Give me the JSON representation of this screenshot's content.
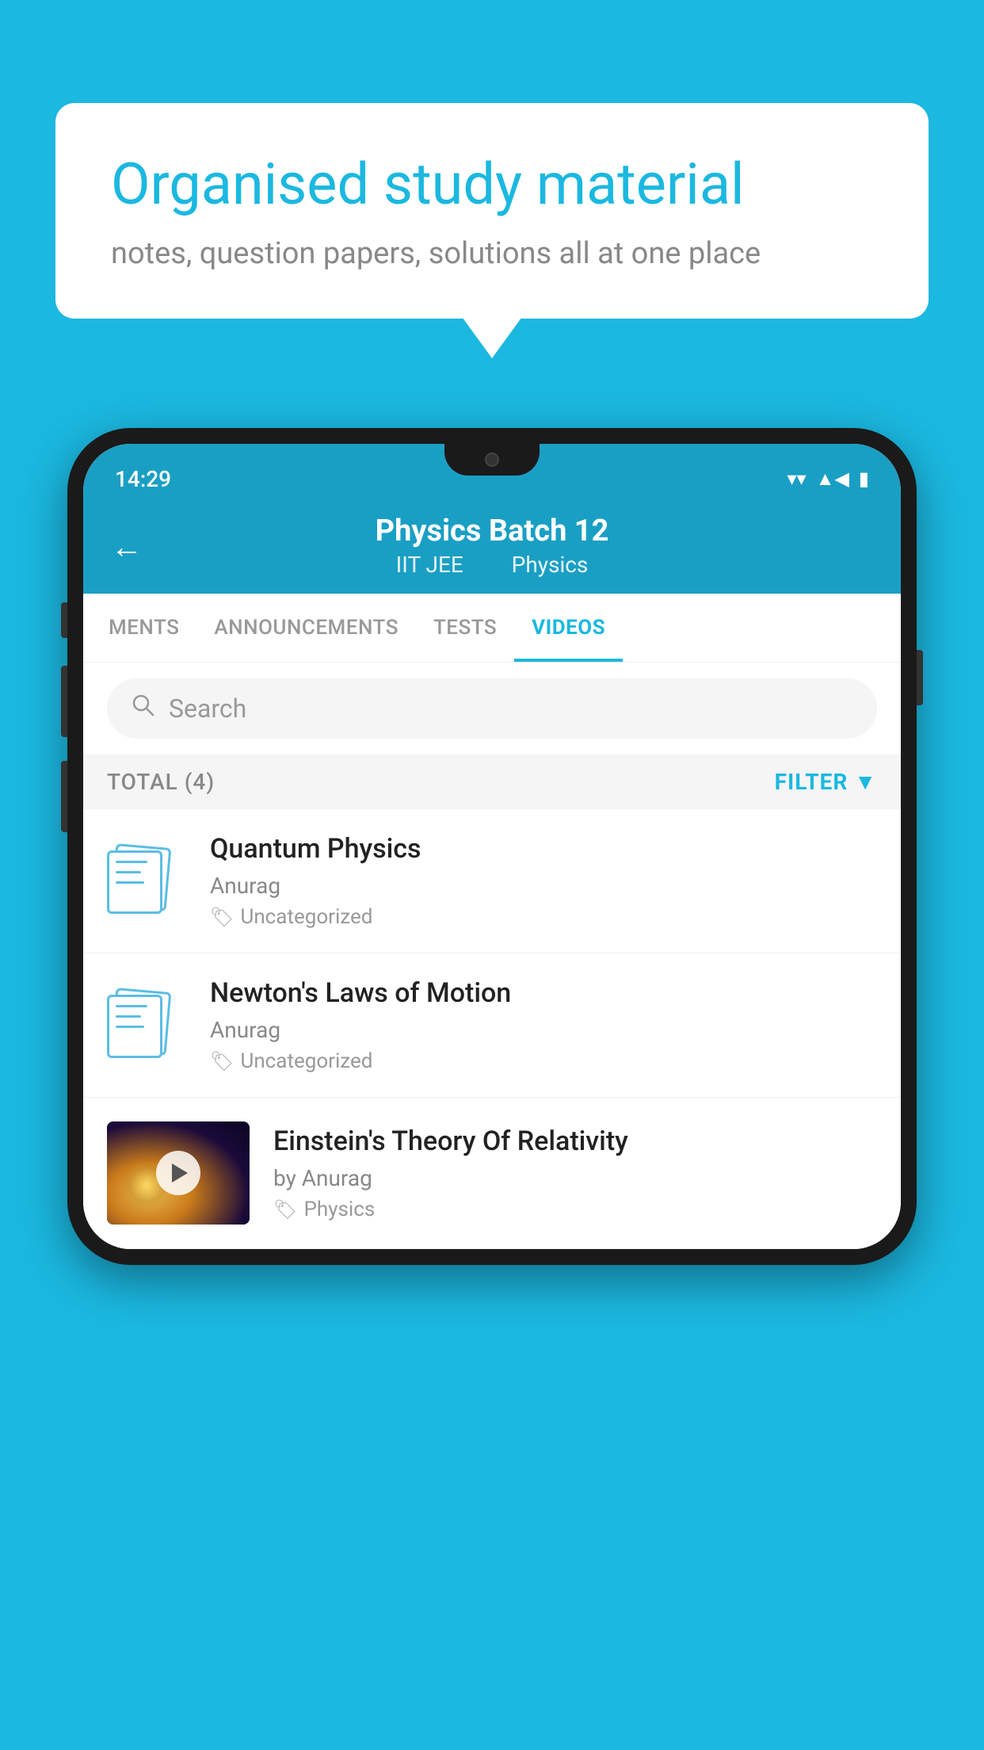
{
  "background_color": "#1BB8E0",
  "speech_bubble": {
    "title": "Organised study material",
    "subtitle": "notes, question papers, solutions all at one place"
  },
  "phone": {
    "status_bar": {
      "time": "14:29"
    },
    "header": {
      "title": "Physics Batch 12",
      "subtitle_left": "IIT JEE",
      "subtitle_right": "Physics",
      "back_label": "←"
    },
    "tabs": [
      {
        "label": "MENTS",
        "active": false
      },
      {
        "label": "ANNOUNCEMENTS",
        "active": false
      },
      {
        "label": "TESTS",
        "active": false
      },
      {
        "label": "VIDEOS",
        "active": true
      }
    ],
    "search": {
      "placeholder": "Search"
    },
    "filter": {
      "total_label": "TOTAL (4)",
      "filter_label": "FILTER"
    },
    "videos": [
      {
        "id": 1,
        "title": "Quantum Physics",
        "author": "Anurag",
        "tag": "Uncategorized",
        "has_thumbnail": false
      },
      {
        "id": 2,
        "title": "Newton's Laws of Motion",
        "author": "Anurag",
        "tag": "Uncategorized",
        "has_thumbnail": false
      },
      {
        "id": 3,
        "title": "Einstein's Theory Of Relativity",
        "author": "by Anurag",
        "tag": "Physics",
        "has_thumbnail": true
      }
    ]
  }
}
